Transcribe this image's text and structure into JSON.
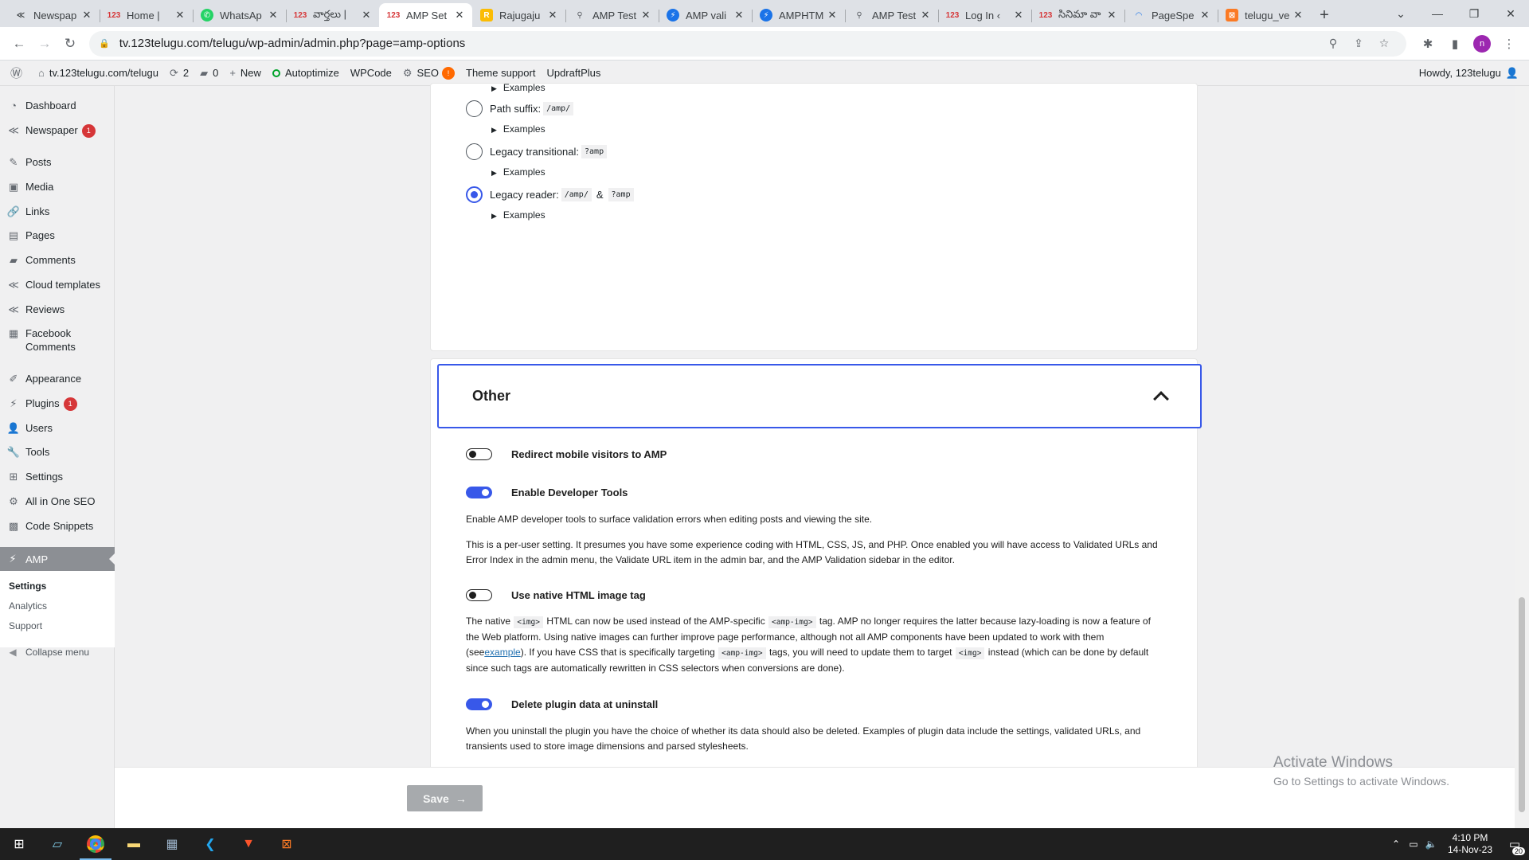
{
  "browser": {
    "tabs": [
      {
        "label": "Newspap",
        "icon": "newspaper-favicon",
        "active": false
      },
      {
        "label": "Home |",
        "icon": "123-favicon",
        "active": false
      },
      {
        "label": "WhatsAp",
        "icon": "whatsapp-favicon",
        "active": false
      },
      {
        "label": "వార్తలు |",
        "icon": "123-favicon",
        "active": false
      },
      {
        "label": "AMP Set",
        "icon": "123-favicon",
        "active": true
      },
      {
        "label": "Rajugaju",
        "icon": "rajugaju-favicon",
        "active": false
      },
      {
        "label": "AMP Test",
        "icon": "amp-test-favicon",
        "active": false
      },
      {
        "label": "AMP vali",
        "icon": "amp-favicon",
        "active": false
      },
      {
        "label": "AMPHTM",
        "icon": "amp-favicon",
        "active": false
      },
      {
        "label": "AMP Test",
        "icon": "amp-test-favicon",
        "active": false
      },
      {
        "label": "Log In ‹",
        "icon": "123-favicon",
        "active": false
      },
      {
        "label": "సినిమా వా",
        "icon": "123-favicon",
        "active": false
      },
      {
        "label": "PageSpe",
        "icon": "pagespeed-favicon",
        "active": false
      },
      {
        "label": "telugu_ve",
        "icon": "xampp-favicon",
        "active": false
      }
    ],
    "url": "tv.123telugu.com/telugu/wp-admin/admin.php?page=amp-options",
    "profile_initial": "n"
  },
  "adminbar": {
    "site": "tv.123telugu.com/telugu",
    "updates": "2",
    "comments": "0",
    "new": "New",
    "autoptimize": "Autoptimize",
    "wpcode": "WPCode",
    "seo": "SEO",
    "seo_badge": "!",
    "theme_support": "Theme support",
    "updraft": "UpdraftPlus",
    "howdy": "Howdy, 123telugu"
  },
  "sidebar": {
    "items": [
      {
        "label": "Dashboard",
        "icon": "dashboard-icon"
      },
      {
        "label": "Newspaper",
        "icon": "newspaper-icon",
        "badge": "1"
      },
      {
        "label": "Posts",
        "icon": "pin-icon"
      },
      {
        "label": "Media",
        "icon": "media-icon"
      },
      {
        "label": "Links",
        "icon": "link-icon"
      },
      {
        "label": "Pages",
        "icon": "pages-icon"
      },
      {
        "label": "Comments",
        "icon": "comment-icon"
      },
      {
        "label": "Cloud templates",
        "icon": "newspaper-icon"
      },
      {
        "label": "Reviews",
        "icon": "newspaper-icon"
      },
      {
        "label": "Facebook Comments",
        "icon": "facebook-icon"
      },
      {
        "label": "Appearance",
        "icon": "brush-icon"
      },
      {
        "label": "Plugins",
        "icon": "plugin-icon",
        "badge": "1"
      },
      {
        "label": "Users",
        "icon": "users-icon"
      },
      {
        "label": "Tools",
        "icon": "wrench-icon"
      },
      {
        "label": "Settings",
        "icon": "settings-icon"
      },
      {
        "label": "All in One SEO",
        "icon": "seo-icon"
      },
      {
        "label": "Code Snippets",
        "icon": "code-icon"
      }
    ],
    "active": "AMP",
    "submenu": [
      "Settings",
      "Analytics",
      "Support"
    ],
    "collapse": "Collapse menu"
  },
  "paired_url": {
    "examples_label": "Examples",
    "options": [
      {
        "label": "Path suffix:",
        "codes": [
          "/amp/"
        ],
        "checked": false
      },
      {
        "label": "Legacy transitional:",
        "codes": [
          "?amp"
        ],
        "checked": false
      },
      {
        "label": "Legacy reader:",
        "codes": [
          "/amp/",
          "?amp"
        ],
        "joiner": "&",
        "checked": true
      }
    ]
  },
  "other": {
    "title": "Other",
    "redirect": {
      "label": "Redirect mobile visitors to AMP",
      "on": false
    },
    "dev_tools": {
      "label": "Enable Developer Tools",
      "on": true,
      "desc1": "Enable AMP developer tools to surface validation errors when editing posts and viewing the site.",
      "desc2": "This is a per-user setting. It presumes you have some experience coding with HTML, CSS, JS, and PHP. Once enabled you will have access to Validated URLs and Error Index in the admin menu, the Validate URL item in the admin bar, and the AMP Validation sidebar in the editor."
    },
    "native_img": {
      "label": "Use native HTML image tag",
      "on": false,
      "t1": "The native",
      "c1": "<img>",
      "t2": "HTML can now be used instead of the AMP-specific",
      "c2": "<amp-img>",
      "t3": "tag. AMP no longer requires the latter because lazy-loading is now a feature of the Web platform. Using native images can further improve page performance, although not all AMP components have been updated to work with them (see",
      "link": "example",
      "t4": "). If you have CSS that is specifically targeting",
      "c3": "<amp-img>",
      "t5": "tags, you will need to update them to target",
      "c4": "<img>",
      "t6": "instead (which can be done by default since such tags are automatically rewritten in CSS selectors when conversions are done)."
    },
    "delete_data": {
      "label": "Delete plugin data at uninstall",
      "on": true,
      "desc": "When you uninstall the plugin you have the choice of whether its data should also be deleted. Examples of plugin data include the settings, validated URLs, and transients used to store image dimensions and parsed stylesheets."
    }
  },
  "save": {
    "label": "Save",
    "arrow": "→"
  },
  "watermark": {
    "line1": "Activate Windows",
    "line2": "Go to Settings to activate Windows."
  },
  "taskbar": {
    "apps": [
      "start-icon",
      "notepad-icon",
      "chrome-icon",
      "file-explorer-icon",
      "calculator-icon",
      "vscode-icon",
      "brave-icon",
      "xampp-icon"
    ],
    "time": "4:10 PM",
    "date": "14-Nov-23",
    "notifications": "20"
  }
}
